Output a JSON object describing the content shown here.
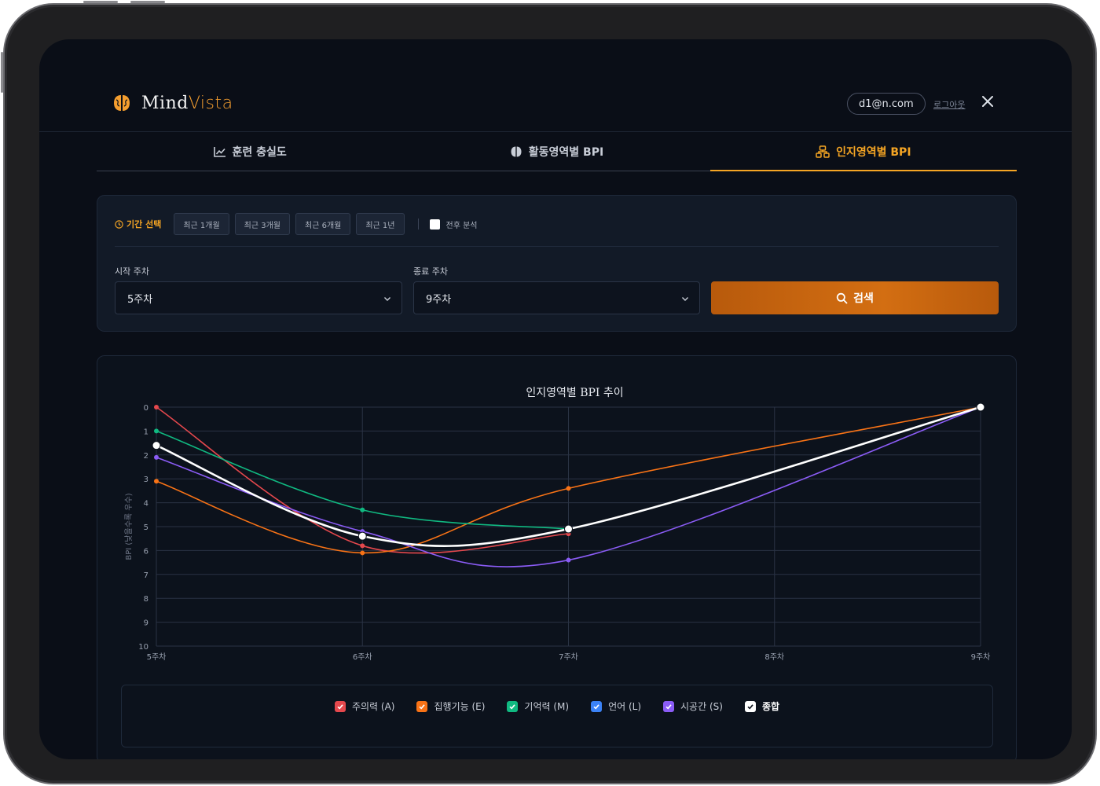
{
  "app": {
    "brand_main": "Mind",
    "brand_accent": "Vista"
  },
  "header": {
    "email": "d1@n.com",
    "logout_label": "로그아웃"
  },
  "tabs": [
    {
      "label": "훈련 충실도",
      "icon": "line-chart-icon"
    },
    {
      "label": "활동영역별 BPI",
      "icon": "brain-icon"
    },
    {
      "label": "인지영역별 BPI",
      "icon": "hierarchy-icon",
      "active": true
    }
  ],
  "filter": {
    "period_label": "기간 선택",
    "period_options": [
      "최근 1개월",
      "최근 3개월",
      "최근 6개월",
      "최근 1년"
    ],
    "compare_label": "전후 분석",
    "start_label": "시작 주차",
    "start_value": "5주차",
    "end_label": "종료 주차",
    "end_value": "9주차",
    "search_label": "검색"
  },
  "colors": {
    "accent": "#f5a524",
    "attention": "#e5484d",
    "executive": "#f97316",
    "memory": "#10b981",
    "language": "#3b82f6",
    "visuospatial": "#8b5cf6",
    "total": "#ffffff"
  },
  "chart_data": {
    "type": "line",
    "title": "인지영역별 BPI 추이",
    "ylabel": "BPI (낮을수록 우수)",
    "x": [
      "5주차",
      "6주차",
      "7주차",
      "8주차",
      "9주차"
    ],
    "x_pos": [
      5,
      6,
      7,
      8,
      9
    ],
    "ylim": [
      0,
      10
    ],
    "y_inverted": true,
    "y_ticks": [
      0,
      1,
      2,
      3,
      4,
      5,
      6,
      7,
      8,
      9,
      10
    ],
    "grid": true,
    "series": [
      {
        "name": "주의력 (A)",
        "color": "#e5484d",
        "x": [
          5,
          6,
          7
        ],
        "values": [
          0,
          5.8,
          5.3
        ]
      },
      {
        "name": "집행기능 (E)",
        "color": "#f97316",
        "x": [
          5,
          6,
          7,
          9
        ],
        "values": [
          3.1,
          6.1,
          3.4,
          0
        ]
      },
      {
        "name": "기억력 (M)",
        "color": "#10b981",
        "x": [
          5,
          6,
          7
        ],
        "values": [
          1.0,
          4.3,
          5.1
        ]
      },
      {
        "name": "언어 (L)",
        "color": "#3b82f6",
        "x": [],
        "values": []
      },
      {
        "name": "시공간 (S)",
        "color": "#8b5cf6",
        "x": [
          5,
          6,
          7,
          9
        ],
        "values": [
          2.1,
          5.2,
          6.4,
          0
        ]
      },
      {
        "name": "종합",
        "color": "#ffffff",
        "x": [
          5,
          6,
          7,
          9
        ],
        "values": [
          1.6,
          5.4,
          5.1,
          0
        ]
      }
    ]
  }
}
